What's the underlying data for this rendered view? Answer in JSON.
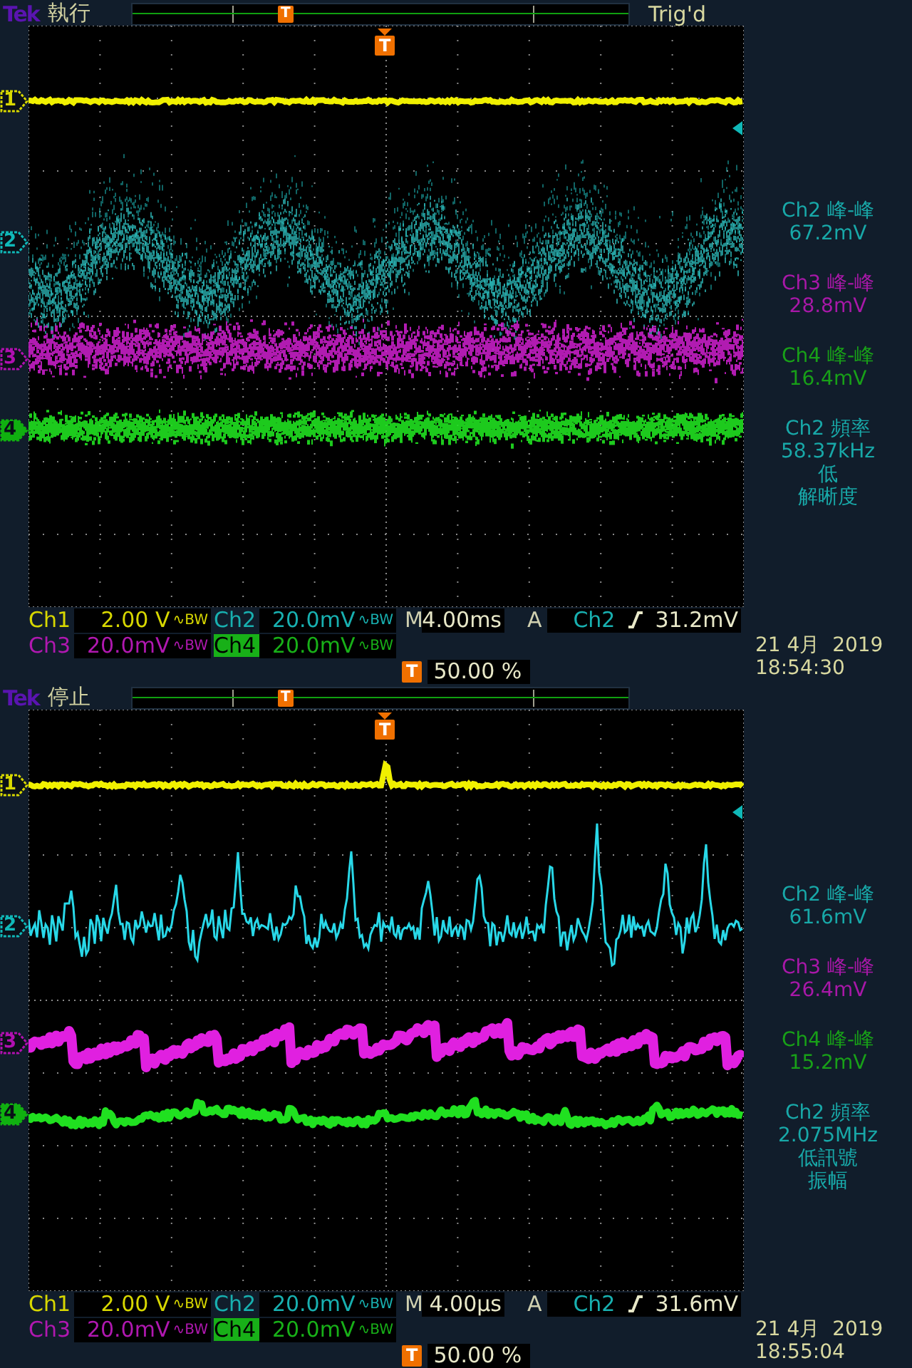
{
  "screens": [
    {
      "kind": "noisy",
      "brand": "Tek",
      "run_state": "執行",
      "trigger_status": "Trig'd",
      "record_marker": "T",
      "screen_marker": "T",
      "markers": [
        {
          "label": "1",
          "color": "#d8d800",
          "selected": false
        },
        {
          "label": "2",
          "color": "#10b8b8",
          "selected": false
        },
        {
          "label": "3",
          "color": "#b010b0",
          "selected": false
        },
        {
          "label": "4",
          "color": "#10b010",
          "selected": true
        }
      ],
      "measurements": [
        {
          "color": "#18a8a8",
          "lines": [
            "Ch2 峰-峰",
            "67.2mV"
          ]
        },
        {
          "color": "#a818a8",
          "lines": [
            "Ch3 峰-峰",
            "28.8mV"
          ]
        },
        {
          "color": "#18a018",
          "lines": [
            "Ch4 峰-峰",
            "16.4mV"
          ]
        },
        {
          "color": "#18a8a8",
          "lines": [
            "Ch2 頻率",
            "58.37kHz",
            "低",
            "解晰度"
          ]
        }
      ],
      "vertical": [
        {
          "channel": "Ch1",
          "scale": "2.00 V",
          "bandwidth": "∿BW",
          "color": "#d8d800",
          "selected": false
        },
        {
          "channel": "Ch2",
          "scale": "20.0mV",
          "bandwidth": "∿BW",
          "color": "#18b0b0",
          "selected": false
        },
        {
          "channel": "Ch3",
          "scale": "20.0mV",
          "bandwidth": "∿BW",
          "color": "#b018b0",
          "selected": false
        },
        {
          "channel": "Ch4",
          "scale": "20.0mV",
          "bandwidth": "∿BW",
          "color": "#18b018",
          "selected": true
        }
      ],
      "horizontal": {
        "prefix": "M",
        "scale": "4.00ms"
      },
      "trigger": {
        "mode": "A",
        "source": "Ch2",
        "level": "31.2mV"
      },
      "trigger_position": {
        "marker": "T",
        "value": "50.00 %"
      },
      "date": "21 4月  2019",
      "time": "18:54:30"
    },
    {
      "kind": "spiky",
      "brand": "Tek",
      "run_state": "停止",
      "record_marker": "T",
      "screen_marker": "T",
      "markers": [
        {
          "label": "1",
          "color": "#d8d800",
          "selected": false
        },
        {
          "label": "2",
          "color": "#10b8b8",
          "selected": false
        },
        {
          "label": "3",
          "color": "#b010b0",
          "selected": false
        },
        {
          "label": "4",
          "color": "#10b010",
          "selected": true
        }
      ],
      "measurements": [
        {
          "color": "#18a8a8",
          "lines": [
            "Ch2 峰-峰",
            "61.6mV"
          ]
        },
        {
          "color": "#a818a8",
          "lines": [
            "Ch3 峰-峰",
            "26.4mV"
          ]
        },
        {
          "color": "#18a018",
          "lines": [
            "Ch4 峰-峰",
            "15.2mV"
          ]
        },
        {
          "color": "#18a8a8",
          "lines": [
            "Ch2 頻率",
            "2.075MHz",
            "低訊號",
            "振幅"
          ]
        }
      ],
      "vertical": [
        {
          "channel": "Ch1",
          "scale": "2.00 V",
          "bandwidth": "∿BW",
          "color": "#d8d800",
          "selected": false
        },
        {
          "channel": "Ch2",
          "scale": "20.0mV",
          "bandwidth": "∿BW",
          "color": "#18b0b0",
          "selected": false
        },
        {
          "channel": "Ch3",
          "scale": "20.0mV",
          "bandwidth": "∿BW",
          "color": "#b018b0",
          "selected": false
        },
        {
          "channel": "Ch4",
          "scale": "20.0mV",
          "bandwidth": "∿BW",
          "color": "#18b018",
          "selected": true
        }
      ],
      "horizontal": {
        "prefix": "M",
        "scale": "4.00µs"
      },
      "trigger": {
        "mode": "A",
        "source": "Ch2",
        "level": "31.6mV"
      },
      "trigger_position": {
        "marker": "T",
        "value": "50.00 %"
      },
      "date": "21 4月  2019",
      "time": "18:55:04"
    }
  ]
}
